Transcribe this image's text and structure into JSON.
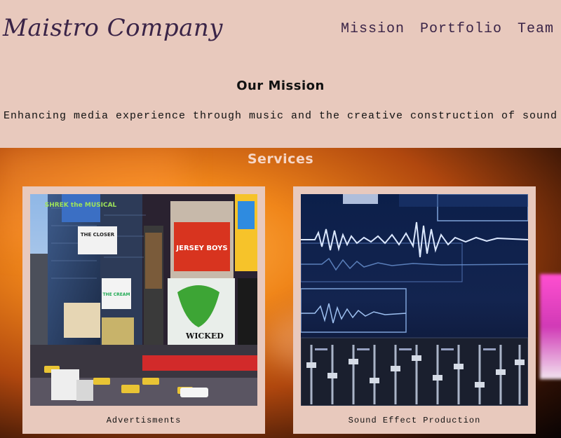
{
  "header": {
    "logo": "Maistro Company",
    "nav": [
      "Mission",
      "Portfolio",
      "Team"
    ]
  },
  "mission": {
    "title": "Our Mission",
    "text": "Enhancing media experience through music and the creative construction of sound"
  },
  "services": {
    "title": "Services",
    "cards": [
      {
        "caption": "Advertisments",
        "billboards": [
          "SHREK the MUSICAL",
          "THE CLOSER",
          "JERSEY BOYS",
          "WICKED",
          "THE CREAM"
        ]
      },
      {
        "caption": "Sound Effect Production"
      }
    ]
  }
}
